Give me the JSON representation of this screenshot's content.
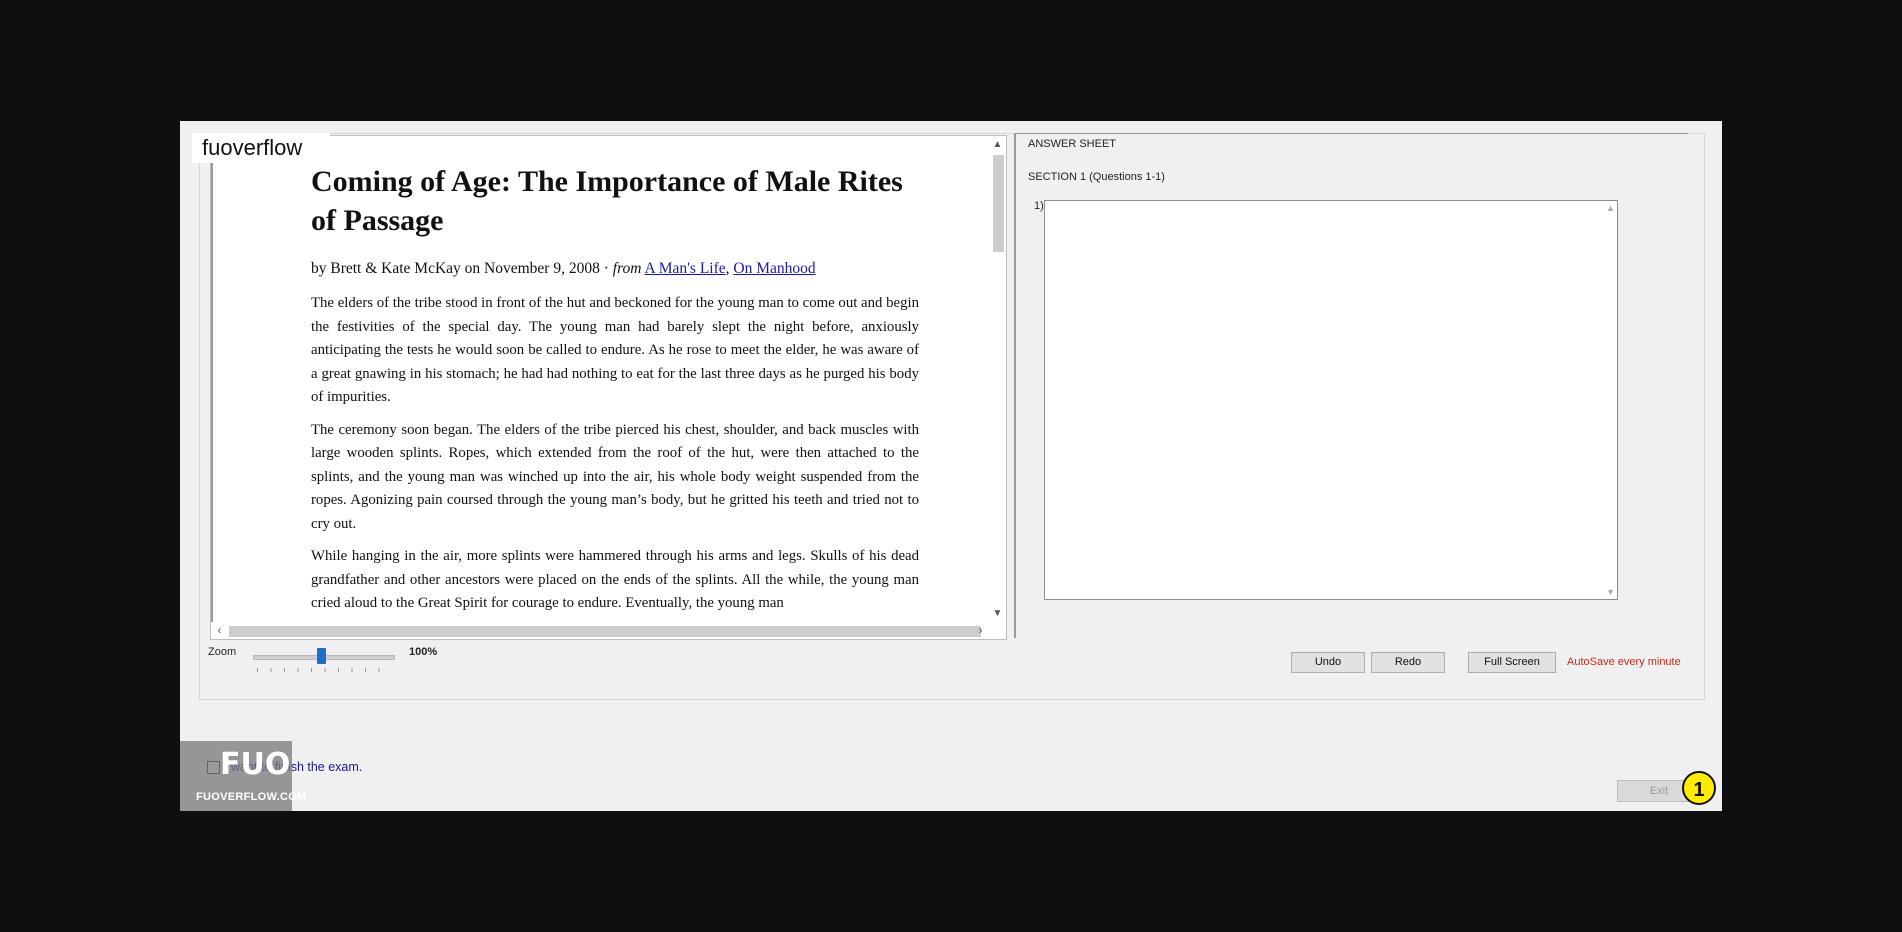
{
  "brand": {
    "label": "fuoverflow"
  },
  "article": {
    "title": "Coming of Age: The Importance of Male Rites of Passage",
    "byline_prefix": "by Brett & Kate McKay on November 9, 2008 · ",
    "byline_from": "from",
    "link1": "A Man's Life",
    "link_sep": ", ",
    "link2": "On Manhood",
    "paragraphs": [
      "The elders of the tribe stood in front of the hut and beckoned for the young man to come out and begin the festivities of the special day. The young man had barely slept the night before, anxiously anticipating the tests he would soon be called to endure. As he rose to meet the elder, he was aware of a great gnawing in his stomach; he had had nothing to eat for the last three days as he purged his body of impurities.",
      "The ceremony soon began. The elders of the tribe pierced his chest, shoulder, and back muscles with large wooden splints. Ropes, which extended from the roof of the hut, were then attached to the splints, and the young man was winched up into the air, his whole body weight suspended from the ropes. Agonizing pain coursed through the young man’s body, but he gritted his teeth and tried not to cry out.",
      "While hanging in the air, more splints were hammered through his arms and legs. Skulls of his dead grandfather and other ancestors were placed on the ends of the splints. All the while, the young man cried aloud to the Great Spirit for courage to endure. Eventually, the young man"
    ]
  },
  "zoom": {
    "label": "Zoom",
    "value": "100%",
    "level_percent": 50
  },
  "answer_sheet": {
    "title": "ANSWER SHEET",
    "section": "SECTION 1 (Questions 1-1)",
    "question_number": "1)",
    "answer_value": ""
  },
  "toolbar": {
    "undo": "Undo",
    "redo": "Redo",
    "fullscreen": "Full Screen",
    "autosave": "AutoSave every minute"
  },
  "finish": {
    "label": "I want to finish the exam."
  },
  "watermark": {
    "big": "FUO",
    "small": "FUOVERFLOW.COM"
  },
  "exit": {
    "label": "Exit"
  },
  "step_badge": "1",
  "colors": {
    "link": "#1a1aa6",
    "autosave": "#c42b1c",
    "zoom_thumb": "#1c6fc8",
    "badge": "#ffec00"
  }
}
